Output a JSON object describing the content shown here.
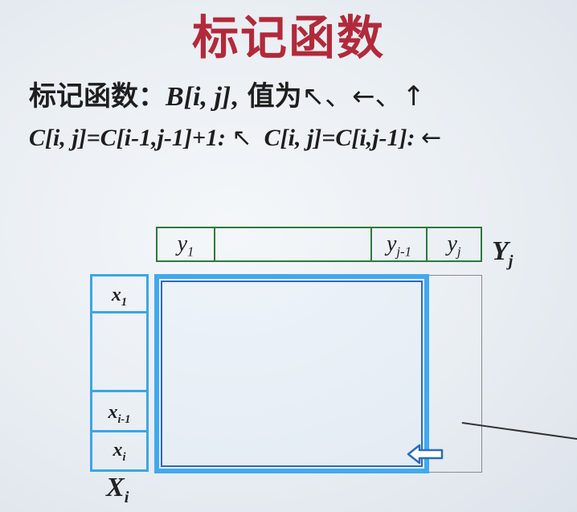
{
  "title": "标记函数",
  "line1": {
    "prefix": "标记函数：",
    "func": "B",
    "args": "[i, j]",
    "comma": ",",
    "value_label": " 值为",
    "arrows": "↖、←、↑"
  },
  "line2": {
    "eq1": "C[i, j]=C[i-1,j-1]+1:",
    "arrow1": "↖",
    "eq2": "C[i, j]=C[i,j-1]:",
    "arrow2": "←"
  },
  "y_labels": {
    "y1": "y",
    "y1_sub": "1",
    "yj1": "y",
    "yj1_sub": "j-1",
    "yj": "y",
    "yj_sub": "j",
    "axis": "Y",
    "axis_sub": "j"
  },
  "x_labels": {
    "x1": "x",
    "x1_sub": "1",
    "xi1": "x",
    "xi1_sub": "i-1",
    "xi": "x",
    "xi_sub": "i",
    "axis": "X",
    "axis_sub": "i"
  },
  "colors": {
    "title": "#b22a3a",
    "blue_frame": "#41a9ec",
    "green_frame": "#2c7a3c"
  }
}
